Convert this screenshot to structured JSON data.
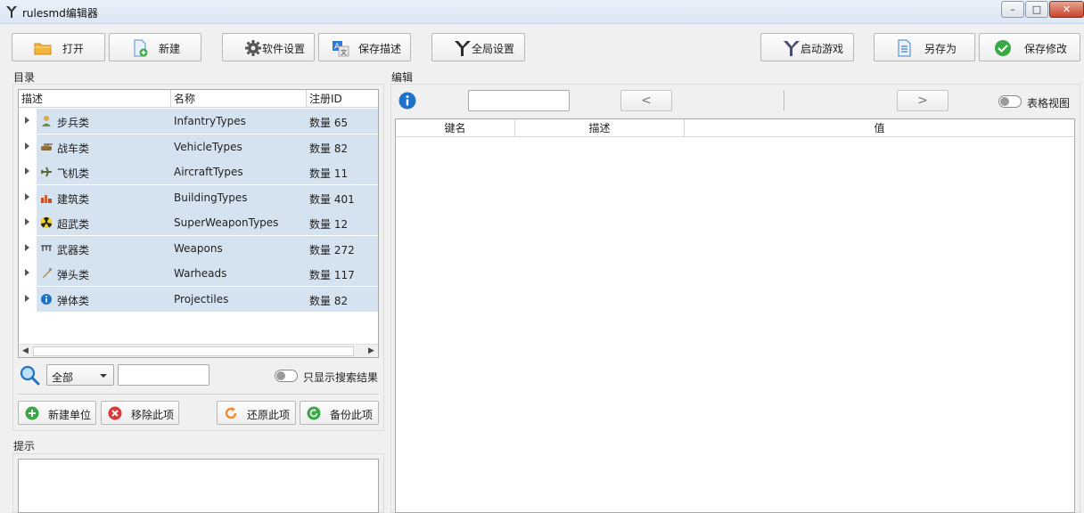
{
  "window": {
    "title": "rulesmd编辑器",
    "controls": {
      "minimize": "–",
      "maximize": "□",
      "close": "✕"
    }
  },
  "toolbar": {
    "open_label": "打开",
    "new_label": "新建",
    "software_settings_label": "软件设置",
    "save_desc_label": "保存描述",
    "global_settings_label": "全局设置",
    "launch_game_label": "启动游戏",
    "save_as_label": "另存为",
    "save_changes_label": "保存修改"
  },
  "left": {
    "catalog_label": "目录",
    "columns": [
      "描述",
      "名称",
      "注册ID"
    ],
    "rows": [
      {
        "desc": "步兵类",
        "name": "InfantryTypes",
        "count": "数量 65",
        "icon": "infantry-icon"
      },
      {
        "desc": "战车类",
        "name": "VehicleTypes",
        "count": "数量 82",
        "icon": "tank-icon"
      },
      {
        "desc": "飞机类",
        "name": "AircraftTypes",
        "count": "数量 11",
        "icon": "aircraft-icon"
      },
      {
        "desc": "建筑类",
        "name": "BuildingTypes",
        "count": "数量 401",
        "icon": "building-icon"
      },
      {
        "desc": "超武类",
        "name": "SuperWeaponTypes",
        "count": "数量 12",
        "icon": "radiation-icon"
      },
      {
        "desc": "武器类",
        "name": "Weapons",
        "count": "数量 272",
        "icon": "weapon-icon"
      },
      {
        "desc": "弹头类",
        "name": "Warheads",
        "count": "数量 117",
        "icon": "warhead-icon"
      },
      {
        "desc": "弹体类",
        "name": "Projectiles",
        "count": "数量 82",
        "icon": "info-small-icon"
      }
    ],
    "filter_value": "全部",
    "search_value": "",
    "search_only_label": "只显示搜索结果",
    "buttons": {
      "new_unit": "新建单位",
      "remove_item": "移除此项",
      "restore_item": "还原此项",
      "backup_item": "备份此项"
    },
    "hint_label": "提示"
  },
  "right": {
    "edit_label": "编辑",
    "edit_value": "",
    "nav_prev": "<",
    "nav_next": ">",
    "table_view_label": "表格视图",
    "columns": [
      "键名",
      "描述",
      "值"
    ]
  },
  "colors": {
    "row_selected": "#d5e3f0",
    "accent_blue": "#1e73c8",
    "save_green": "#3aa845",
    "remove_red": "#d83a3a",
    "folder_yellow": "#f2b53a"
  }
}
